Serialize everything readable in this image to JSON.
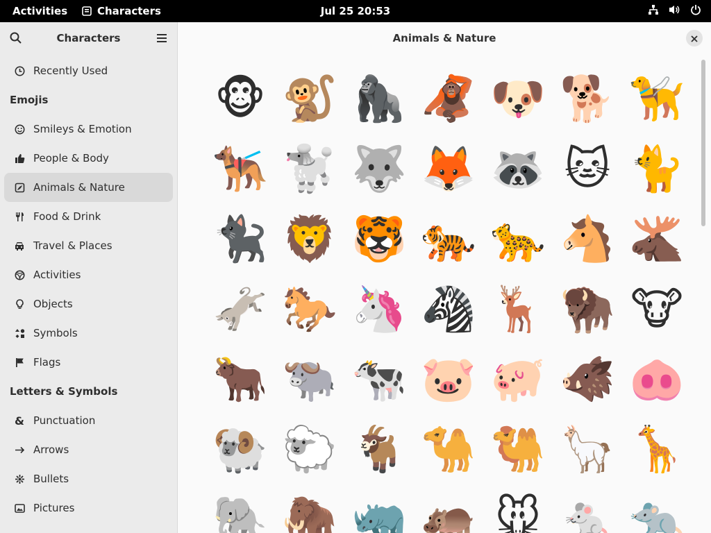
{
  "topbar": {
    "activities": "Activities",
    "app_name": "Characters",
    "clock": "Jul 25  20:53"
  },
  "sidebar": {
    "title": "Characters",
    "sections": [
      {
        "heading": "",
        "items": [
          {
            "label": "Recently Used",
            "icon": "clock-icon",
            "active": false
          }
        ]
      },
      {
        "heading": "Emojis",
        "items": [
          {
            "label": "Smileys & Emotion",
            "icon": "smiley-icon",
            "active": false
          },
          {
            "label": "People & Body",
            "icon": "thumbs-up-icon",
            "active": false
          },
          {
            "label": "Animals & Nature",
            "icon": "nature-icon",
            "active": true
          },
          {
            "label": "Food & Drink",
            "icon": "fork-knife-icon",
            "active": false
          },
          {
            "label": "Travel & Places",
            "icon": "car-icon",
            "active": false
          },
          {
            "label": "Activities",
            "icon": "activities-icon",
            "active": false
          },
          {
            "label": "Objects",
            "icon": "lightbulb-icon",
            "active": false
          },
          {
            "label": "Symbols",
            "icon": "symbols-icon",
            "active": false
          },
          {
            "label": "Flags",
            "icon": "flag-icon",
            "active": false
          }
        ]
      },
      {
        "heading": "Letters & Symbols",
        "items": [
          {
            "label": "Punctuation",
            "icon": "ampersand-icon",
            "active": false
          },
          {
            "label": "Arrows",
            "icon": "arrow-right-icon",
            "active": false
          },
          {
            "label": "Bullets",
            "icon": "bullet-icon",
            "active": false
          },
          {
            "label": "Pictures",
            "icon": "picture-icon",
            "active": false
          }
        ]
      }
    ]
  },
  "main": {
    "title": "Animals & Nature",
    "emojis": [
      "🐵",
      "🐒",
      "🦍",
      "🦧",
      "🐶",
      "🐕",
      "🦮",
      "🐕‍🦺",
      "🐩",
      "🐺",
      "🦊",
      "🦝",
      "🐱",
      "🐈",
      "🐈‍⬛",
      "🦁",
      "🐯",
      "🐅",
      "🐆",
      "🐴",
      "🫎",
      "🫏",
      "🐎",
      "🦄",
      "🦓",
      "🦌",
      "🦬",
      "🐮",
      "🐂",
      "🐃",
      "🐄",
      "🐷",
      "🐖",
      "🐗",
      "🐽",
      "🐏",
      "🐑",
      "🐐",
      "🐪",
      "🐫",
      "🦙",
      "🦒",
      "🐘",
      "🦣",
      "🦏",
      "🦛",
      "🐭",
      "🐁",
      "🐀"
    ]
  },
  "colors": {
    "topbar_bg": "#000000",
    "sidebar_bg": "#ebebeb",
    "active_item_bg": "#d9d9d9",
    "main_bg": "#fafafa"
  }
}
